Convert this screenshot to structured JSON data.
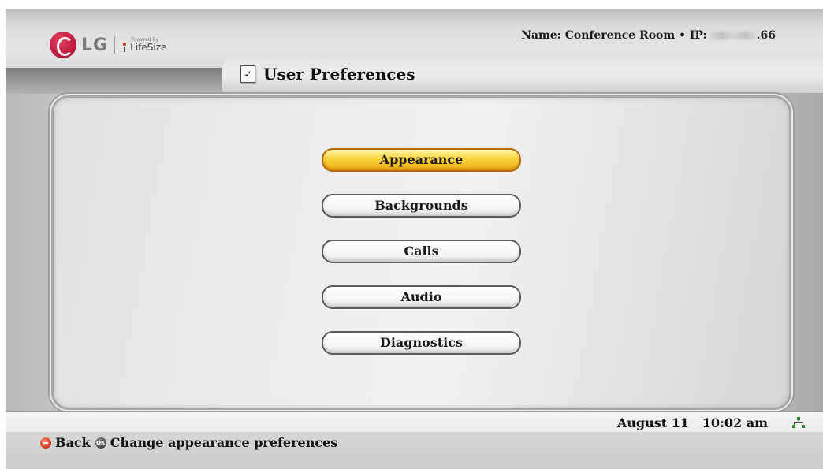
{
  "header": {
    "brand": "LG",
    "powered_by": "Powered By",
    "lifesize": "LifeSize",
    "device_prefix": "Name: Conference Room • IP:",
    "ip_suffix": ".66",
    "page_title": "User Preferences"
  },
  "menu": {
    "items": [
      {
        "label": "Appearance",
        "active": true
      },
      {
        "label": "Backgrounds",
        "active": false
      },
      {
        "label": "Calls",
        "active": false
      },
      {
        "label": "Audio",
        "active": false
      },
      {
        "label": "Diagnostics",
        "active": false
      }
    ]
  },
  "status": {
    "date": "August 11",
    "time": "10:02 am",
    "network_icon": "network-icon"
  },
  "hints": {
    "back_label": "Back",
    "ok_icon_label": "OK",
    "ok_label": "Change appearance preferences"
  },
  "colors": {
    "active_button": "#f8c62a",
    "brand_red": "#b3123a"
  }
}
